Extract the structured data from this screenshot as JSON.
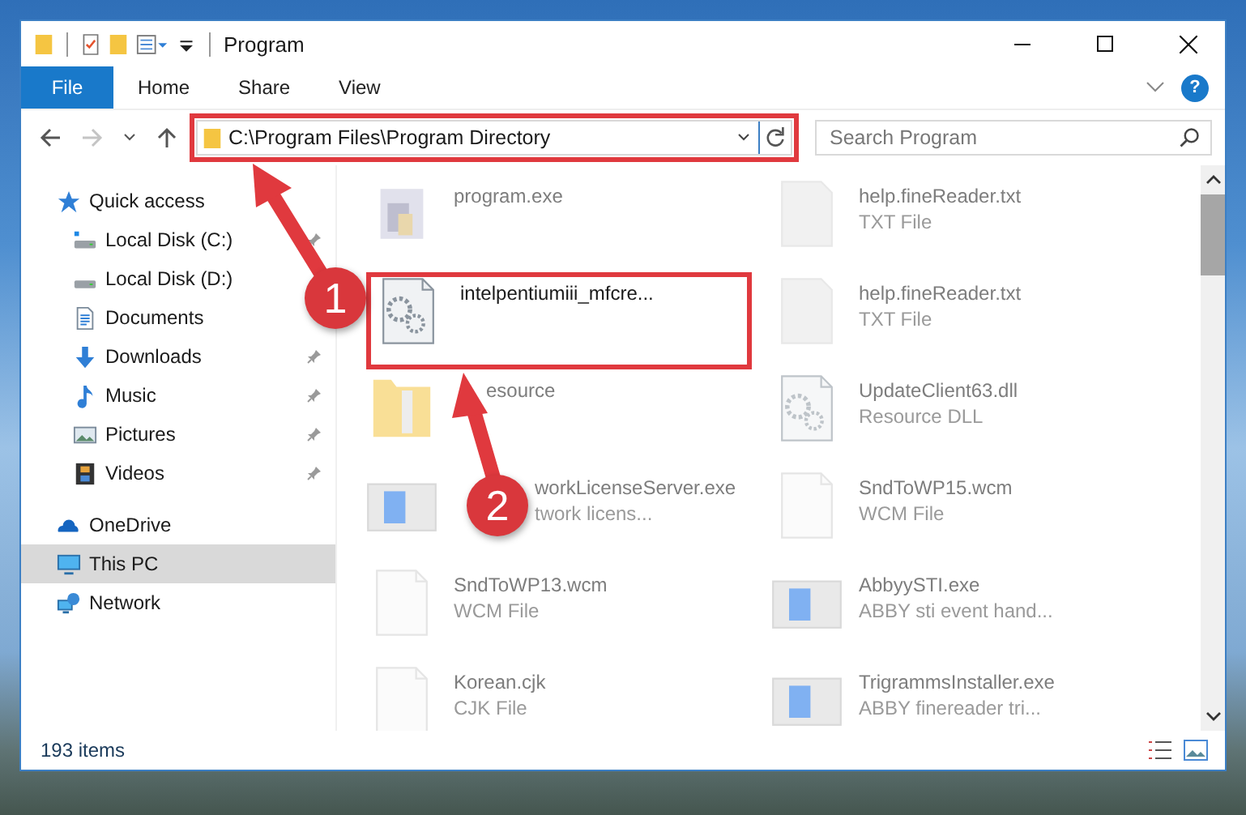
{
  "window": {
    "title": "Program"
  },
  "ribbon": {
    "tabs": [
      {
        "label": "File",
        "selected": true
      },
      {
        "label": "Home",
        "selected": false
      },
      {
        "label": "Share",
        "selected": false
      },
      {
        "label": "View",
        "selected": false
      }
    ],
    "help": "?"
  },
  "address": {
    "path": "C:\\Program Files\\Program Directory",
    "forward_disabled": true,
    "highlighted": true
  },
  "search": {
    "placeholder": "Search Program"
  },
  "sidebar": {
    "items": [
      {
        "label": "Quick access",
        "kind": "star",
        "selected": false,
        "children": [
          {
            "label": "Local Disk (C:)",
            "kind": "system-disk",
            "pinned": true,
            "selected": false
          },
          {
            "label": "Local Disk (D:)",
            "kind": "disk",
            "pinned": false,
            "selected": false
          },
          {
            "label": "Documents",
            "kind": "documents",
            "pinned": false,
            "selected": false
          },
          {
            "label": "Downloads",
            "kind": "downloads",
            "pinned": true,
            "selected": false
          },
          {
            "label": "Music",
            "kind": "music",
            "pinned": true,
            "selected": false
          },
          {
            "label": "Pictures",
            "kind": "pictures",
            "pinned": true,
            "selected": false
          },
          {
            "label": "Videos",
            "kind": "videos",
            "pinned": true,
            "selected": false
          }
        ]
      },
      {
        "label": "OneDrive",
        "kind": "cloud",
        "selected": false
      },
      {
        "label": "This PC",
        "kind": "pc",
        "selected": true
      },
      {
        "label": "Network",
        "kind": "network",
        "selected": false
      }
    ]
  },
  "files": [
    {
      "name": "program.exe",
      "kind": "app",
      "faded": true,
      "highlighted": false
    },
    {
      "name": "help.fineReader.txt",
      "type": "TXT File",
      "kind": "text",
      "faded": true,
      "highlighted": false
    },
    {
      "name": "intelpentiumiii_mfcre...",
      "kind": "settings",
      "faded": false,
      "highlighted": true
    },
    {
      "name": "help.fineReader.txt",
      "type": "TXT File",
      "kind": "text",
      "faded": true,
      "highlighted": false
    },
    {
      "name": "esource",
      "kind": "folder",
      "faded": true,
      "highlighted": false,
      "covered": true
    },
    {
      "name": "UpdateClient63.dll",
      "type": "Resource DLL",
      "kind": "settings",
      "faded": true,
      "highlighted": false
    },
    {
      "name": "workLicenseServer.exe",
      "type": "twork licens...",
      "kind": "window",
      "faded": true,
      "highlighted": false,
      "covered": true
    },
    {
      "name": "SndToWP15.wcm",
      "type": "WCM File",
      "kind": "document",
      "faded": true,
      "highlighted": false
    },
    {
      "name": "SndToWP13.wcm",
      "type": "WCM File",
      "kind": "document",
      "faded": true,
      "highlighted": false
    },
    {
      "name": "AbbyySTI.exe",
      "type": "ABBY sti event hand...",
      "kind": "window",
      "faded": true,
      "highlighted": false
    },
    {
      "name": "Korean.cjk",
      "type": "CJK File",
      "kind": "document",
      "faded": true,
      "highlighted": false
    },
    {
      "name": "TrigrammsInstaller.exe",
      "type": "ABBY finereader tri...",
      "kind": "window",
      "faded": true,
      "highlighted": false
    }
  ],
  "status_bar": {
    "count": "193 items"
  },
  "annotations": [
    {
      "label": "1"
    },
    {
      "label": "2"
    }
  ]
}
